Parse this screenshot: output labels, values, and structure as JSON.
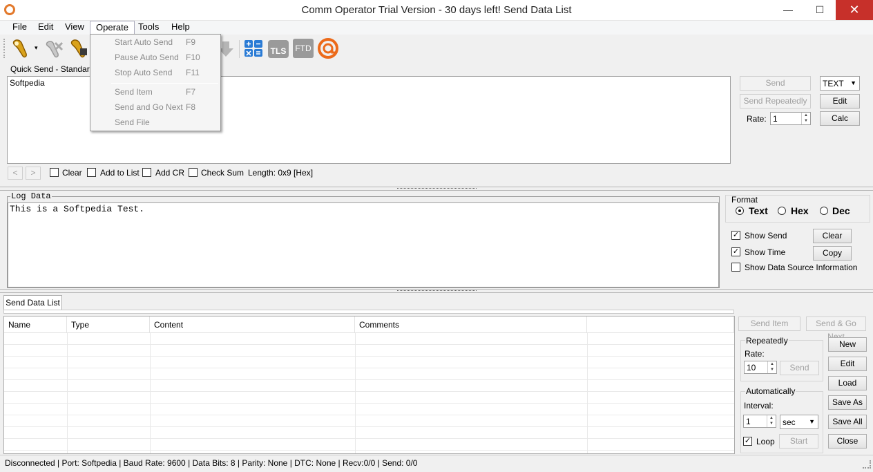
{
  "window": {
    "title": "Comm Operator Trial Version - 30 days left!   Send Data List",
    "minimize_glyph": "—",
    "maximize_glyph": "☐",
    "close_glyph": "✕"
  },
  "menubar": {
    "file": "File",
    "edit": "Edit",
    "view": "View",
    "operate": "Operate",
    "tools": "Tools",
    "help": "Help"
  },
  "operate_menu": {
    "items": [
      {
        "label": "Start Auto Send",
        "shortcut": "F9"
      },
      {
        "label": "Pause Auto Send",
        "shortcut": "F10"
      },
      {
        "label": "Stop Auto Send",
        "shortcut": "F11"
      },
      {
        "label": "Send Item",
        "shortcut": "F7"
      },
      {
        "label": "Send and Go Next",
        "shortcut": "F8"
      },
      {
        "label": "Send File",
        "shortcut": ""
      }
    ]
  },
  "toolbar": {
    "tls_label": "TLS",
    "ftd_label": "FTD",
    "dropdown_glyph": "▾"
  },
  "quick_send": {
    "title": "Quick Send - Standard",
    "content": "Softpedia",
    "send": "Send",
    "send_repeatedly": "Send Repeatedly",
    "format": "TEXT",
    "edit": "Edit",
    "calc": "Calc",
    "rate_label": "Rate:",
    "rate_value": "1",
    "prev_glyph": "<",
    "next_glyph": ">",
    "clear": "Clear",
    "add_to_list": "Add to List",
    "add_cr": "Add CR",
    "check_sum": "Check Sum",
    "length": "Length: 0x9 [Hex]"
  },
  "log": {
    "title": "Log Data",
    "content": "This is a Softpedia Test.",
    "format_title": "Format",
    "fmt_text": "Text",
    "fmt_hex": "Hex",
    "fmt_dec": "Dec",
    "show_send": "Show Send",
    "show_time": "Show Time",
    "show_source": "Show Data Source Information",
    "clear": "Clear",
    "copy": "Copy",
    "check_glyph": "✓"
  },
  "send_list": {
    "tab": "Send Data List",
    "columns": [
      "Name",
      "Type",
      "Content",
      "Comments"
    ],
    "send_item": "Send Item",
    "send_go_next": "Send & Go Next",
    "repeatedly": "Repeatedly",
    "rate_label": "Rate:",
    "rate_value": "10",
    "send": "Send",
    "automatically": "Automatically",
    "interval_label": "Interval:",
    "interval_value": "1",
    "interval_unit": "sec",
    "loop": "Loop",
    "start": "Start",
    "new": "New",
    "edit": "Edit",
    "load": "Load",
    "save_as": "Save As",
    "save_all": "Save All",
    "close": "Close"
  },
  "status": {
    "text": "Disconnected | Port: Softpedia | Baud Rate: 9600 | Data Bits: 8 | Parity: None | DTC: None | Recv:0/0 | Send: 0/0"
  }
}
